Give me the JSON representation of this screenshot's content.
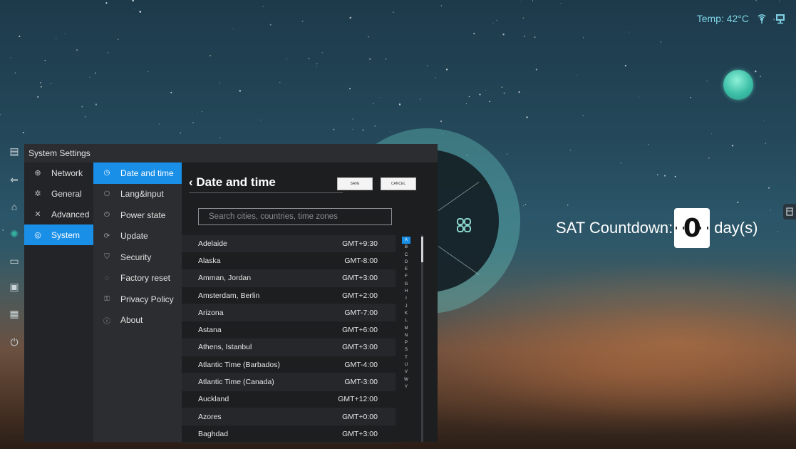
{
  "status": {
    "temp": "Temp: 42°C"
  },
  "countdown": {
    "label": "SAT Countdown:",
    "digit": "0",
    "unit": "day(s)"
  },
  "window": {
    "title": "System Settings"
  },
  "nav": [
    {
      "label": "Network",
      "icon": "globe-icon"
    },
    {
      "label": "General",
      "icon": "gear-icon"
    },
    {
      "label": "Advanced",
      "icon": "tools-icon"
    },
    {
      "label": "System",
      "icon": "system-icon",
      "active": true
    }
  ],
  "subnav": [
    {
      "label": "Date and time",
      "icon": "clock-icon",
      "active": true
    },
    {
      "label": "Lang&input",
      "icon": "language-icon"
    },
    {
      "label": "Power state",
      "icon": "power-icon"
    },
    {
      "label": "Update",
      "icon": "update-icon"
    },
    {
      "label": "Security",
      "icon": "shield-icon"
    },
    {
      "label": "Factory reset",
      "icon": "reset-icon"
    },
    {
      "label": "Privacy Policy",
      "icon": "lock-icon"
    },
    {
      "label": "About",
      "icon": "info-icon"
    }
  ],
  "datetime": {
    "title": "Date and time",
    "save_label": "SAVE",
    "cancel_label": "CANCEL",
    "search_placeholder": "Search cities, countries, time zones",
    "zones": [
      {
        "name": "Adelaide",
        "gmt": "GMT+9:30"
      },
      {
        "name": "Alaska",
        "gmt": "GMT-8:00"
      },
      {
        "name": "Amman, Jordan",
        "gmt": "GMT+3:00"
      },
      {
        "name": "Amsterdam, Berlin",
        "gmt": "GMT+2:00"
      },
      {
        "name": "Arizona",
        "gmt": "GMT-7:00"
      },
      {
        "name": "Astana",
        "gmt": "GMT+6:00"
      },
      {
        "name": "Athens, Istanbul",
        "gmt": "GMT+3:00"
      },
      {
        "name": "Atlantic Time (Barbados)",
        "gmt": "GMT-4:00"
      },
      {
        "name": "Atlantic Time (Canada)",
        "gmt": "GMT-3:00"
      },
      {
        "name": "Auckland",
        "gmt": "GMT+12:00"
      },
      {
        "name": "Azores",
        "gmt": "GMT+0:00"
      },
      {
        "name": "Baghdad",
        "gmt": "GMT+3:00"
      }
    ],
    "alphabet": [
      "A",
      "B",
      "C",
      "D",
      "E",
      "F",
      "G",
      "H",
      "I",
      "J",
      "K",
      "L",
      "M",
      "N",
      "P",
      "S",
      "T",
      "U",
      "V",
      "W",
      "Y"
    ],
    "alphabet_selected": "A"
  },
  "colors": {
    "accent": "#1a8fe8",
    "status_text": "#7fd3e6"
  }
}
